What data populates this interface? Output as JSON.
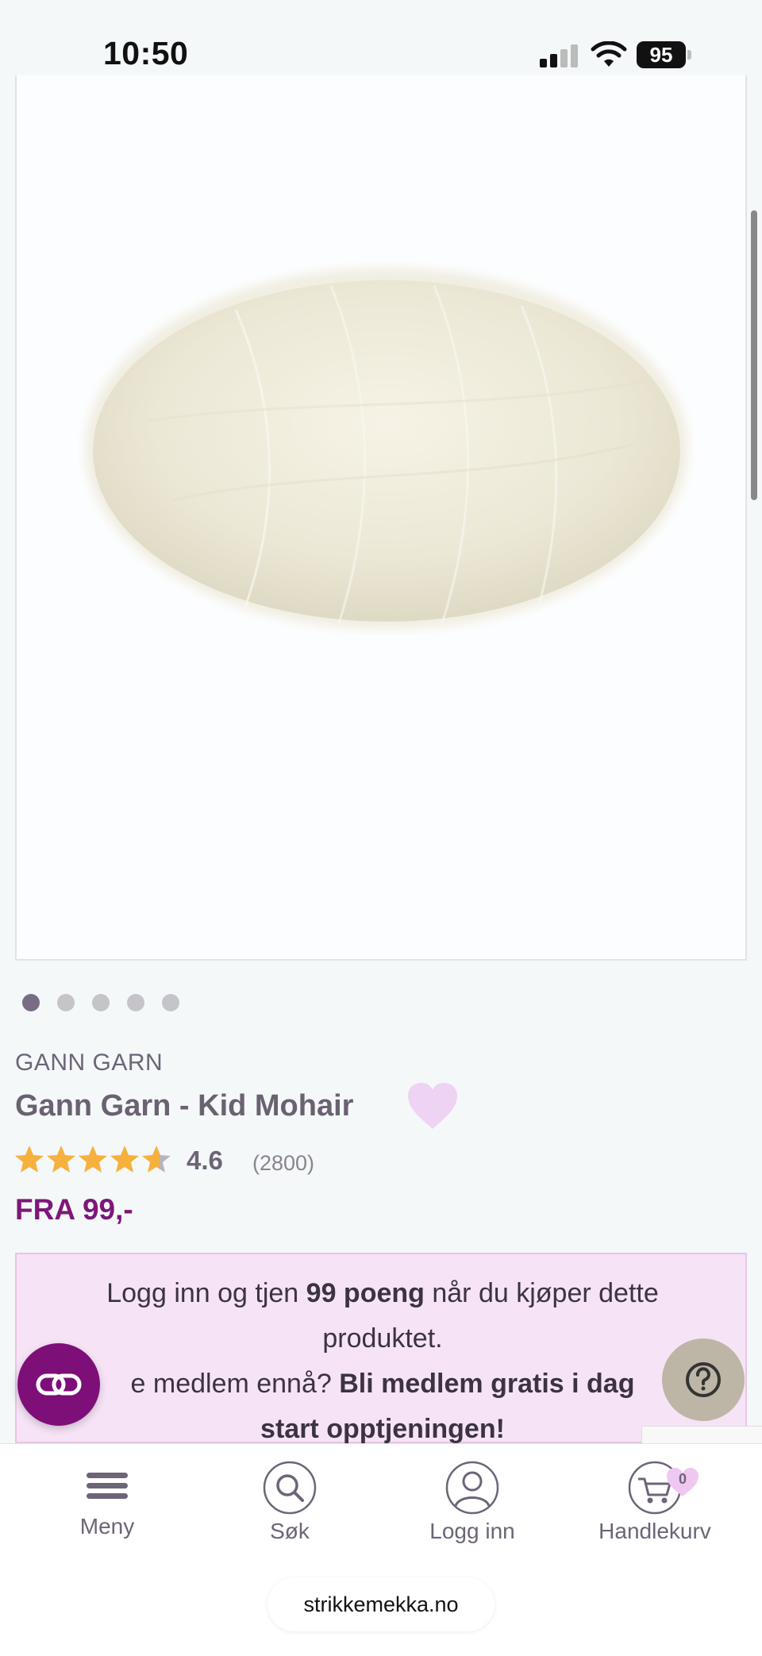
{
  "status_bar": {
    "time": "10:50",
    "battery": "95"
  },
  "product": {
    "brand": "GANN GARN",
    "title": "Gann Garn - Kid Mohair",
    "rating": "4.6",
    "rating_value": 4.6,
    "reviews": "(2800)",
    "price": "FRA 99,-",
    "image_count": 5,
    "active_image": 1
  },
  "loyalty": {
    "line1_pre": "Logg inn og tjen ",
    "line1_bold": "99 poeng",
    "line1_post": " når du kjøper dette",
    "line2": "produktet.",
    "line3_pre": "e medlem ennå? ",
    "line3_bold": "Bli medlem gratis i dag",
    "line4_bold": "start opptjeningen!"
  },
  "nav": {
    "menu": "Meny",
    "search": "Søk",
    "login": "Logg inn",
    "cart": "Handlekurv",
    "cart_count": "0"
  },
  "browser": {
    "url": "strikkemekka.no"
  },
  "colors": {
    "accent": "#7e1779",
    "star": "#f6b13c",
    "heart": "#efd3f4",
    "loyalty_bg": "#f6e4f6"
  }
}
